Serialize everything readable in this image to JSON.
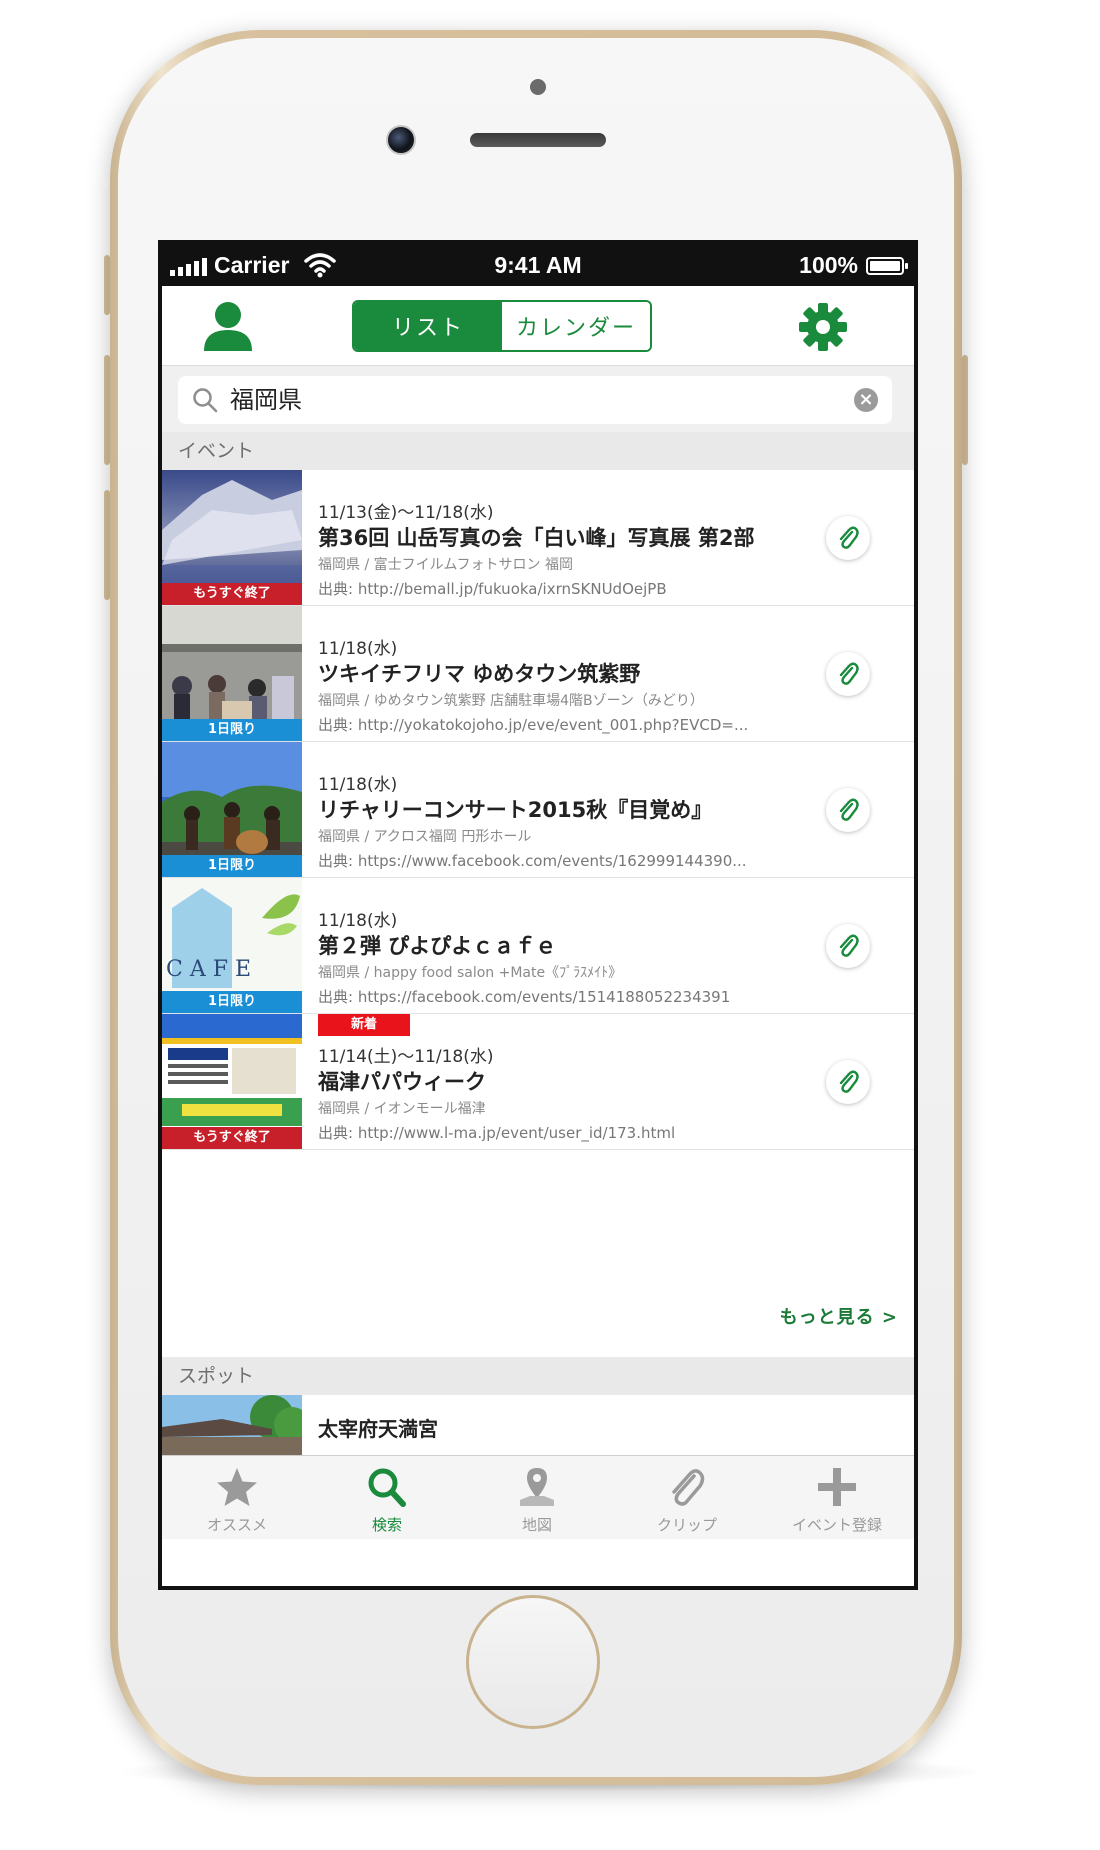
{
  "status_bar": {
    "carrier": "Carrier",
    "time": "9:41 AM",
    "battery": "100%"
  },
  "nav": {
    "segments": [
      "リスト",
      "カレンダー"
    ],
    "selected_segment": "リスト"
  },
  "search": {
    "value": "福岡県",
    "clear_icon": "×"
  },
  "sections": {
    "events_header": "イベント",
    "spots_header": "スポット"
  },
  "events": [
    {
      "badge": "もうすぐ終了",
      "new_label": "",
      "date": "11/13(金)〜11/18(水)",
      "title": "第36回 山岳写真の会「白い峰」写真展 第2部",
      "venue": "福岡県 / 富士フイルムフォトサロン 福岡",
      "source": "出典: http://bemall.jp/fukuoka/ixrnSKNUdOejPB"
    },
    {
      "badge": "1日限り",
      "new_label": "",
      "date": "11/18(水)",
      "title": "ツキイチフリマ ゆめタウン筑紫野",
      "venue": "福岡県 / ゆめタウン筑紫野 店舗駐車場4階Bゾーン（みどり）",
      "source": "出典: http://yokatokojoho.jp/eve/event_001.php?EVCD=..."
    },
    {
      "badge": "1日限り",
      "new_label": "",
      "date": "11/18(水)",
      "title": "リチャリーコンサート2015秋『目覚め』",
      "venue": "福岡県 / アクロス福岡 円形ホール",
      "source": "出典: https://www.facebook.com/events/162999144390..."
    },
    {
      "badge": "1日限り",
      "new_label": "",
      "date": "11/18(水)",
      "title": "第２弾 ぴよぴよｃａｆｅ",
      "venue": "福岡県 / happy food salon +Mate《ﾌﾟﾗｽﾒｲﾄ》",
      "source": "出典: https://facebook.com/events/1514188052234391"
    },
    {
      "badge": "もうすぐ終了",
      "new_label": "新着",
      "date": "11/14(土)〜11/18(水)",
      "title": "福津パパウィーク",
      "venue": "福岡県 / イオンモール福津",
      "source": "出典: http://www.l-ma.jp/event/user_id/173.html"
    }
  ],
  "more_link": "もっと見る >",
  "spots": [
    {
      "title": "太宰府天満宮"
    }
  ],
  "tabs": [
    {
      "label": "オススメ",
      "icon": "star-icon"
    },
    {
      "label": "検索",
      "icon": "search-icon"
    },
    {
      "label": "地図",
      "icon": "map-pin-icon"
    },
    {
      "label": "クリップ",
      "icon": "paperclip-icon"
    },
    {
      "label": "イベント登録",
      "icon": "plus-icon"
    }
  ],
  "colors": {
    "accent": "#1a8a3c",
    "badge_ending": "#c8202a",
    "badge_one_day": "#1b8fd6",
    "badge_new": "#e8131b"
  }
}
